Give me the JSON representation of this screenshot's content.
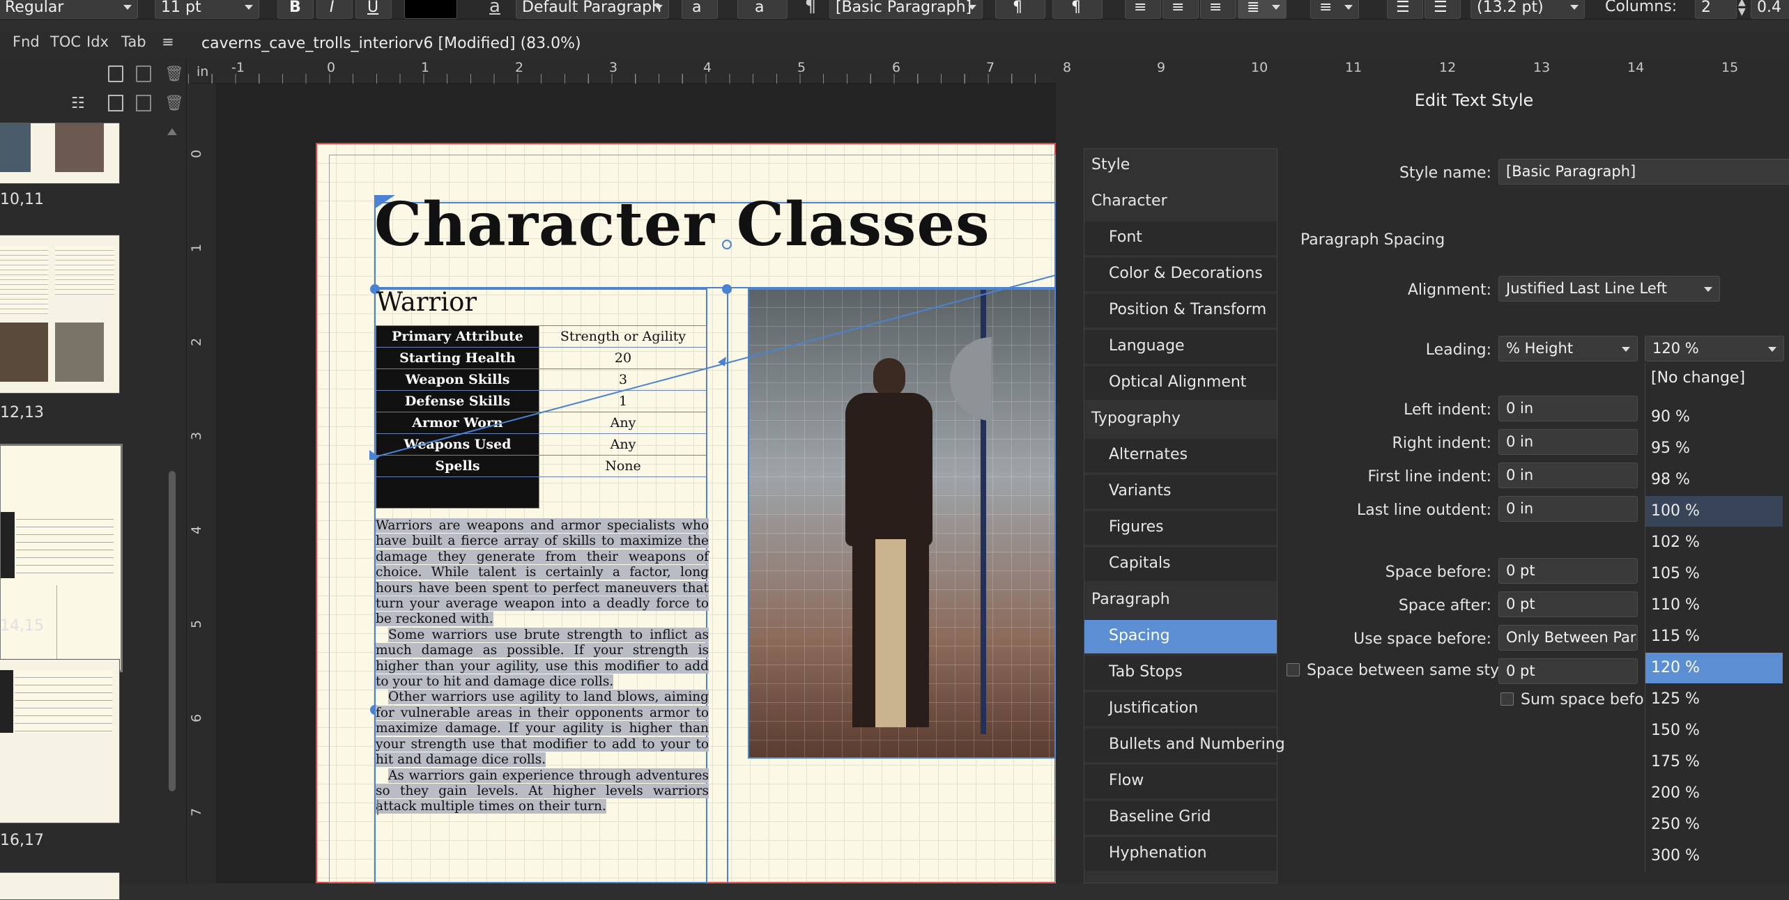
{
  "toolbar": {
    "font_style": "Regular",
    "font_size": "11 pt",
    "bold": "B",
    "italic": "I",
    "underline": "U",
    "text_color": "#000000",
    "char_style_icon": "a",
    "char_style": "Default Paragraph",
    "opentype_icon": "a",
    "paragraph_style_icon": "¶",
    "paragraph_style": "[Basic Paragraph]",
    "leading_value": "(13.2 pt)",
    "columns_label": "Columns:",
    "columns_value": "2",
    "gutter_value": "0.4"
  },
  "left_tabs": [
    "Fnd",
    "TOC",
    "Idx",
    "Tab"
  ],
  "document": {
    "title": "caverns_cave_trolls_interiorv6 [Modified] (83.0%)"
  },
  "pages_panel": {
    "spreads": [
      {
        "label": "10,11"
      },
      {
        "label": "12,13"
      },
      {
        "label": "14,15"
      },
      {
        "label": "16,17"
      }
    ]
  },
  "ruler": {
    "unit": "in",
    "top_ticks": [
      "-1",
      "0",
      "1",
      "2",
      "3",
      "4",
      "5",
      "6",
      "7",
      "8",
      "9",
      "10",
      "11",
      "12",
      "13",
      "14",
      "15"
    ],
    "left_ticks": [
      "0",
      "1",
      "2",
      "3",
      "4",
      "5",
      "6",
      "7"
    ]
  },
  "page": {
    "heading": "Character Classes",
    "subheading": "Warrior",
    "stats": [
      {
        "label": "Primary Attribute",
        "value": "Strength or Agility"
      },
      {
        "label": "Starting Health",
        "value": "20"
      },
      {
        "label": "Weapon Skills",
        "value": "3"
      },
      {
        "label": "Defense Skills",
        "value": "1"
      },
      {
        "label": "Armor Worn",
        "value": "Any"
      },
      {
        "label": "Weapons Used",
        "value": "Any"
      },
      {
        "label": "Spells",
        "value": "None"
      }
    ],
    "paragraphs": [
      "Warriors are weapons and armor specialists who have built a fierce array of skills to maximize the damage they generate from their weapons of choice.  While talent is certainly a factor, long hours have been spent to perfect maneuvers that turn your average weapon into a deadly force to be reckoned with.",
      "Some warriors use brute strength to inflict as much damage as possible.  If your strength is higher than your agility, use this modifier to add to your to hit and damage dice rolls.",
      "Other warriors use agility to land blows, aiming for vulnerable areas in their opponents armor to maximize damage.  If your agility is higher than your strength use that modifier to add to your to hit and damage dice rolls.",
      "As warriors gain experience through adventures so they gain levels.  At higher levels warriors attack multiple times on their turn."
    ]
  },
  "dialog": {
    "title": "Edit Text Style",
    "categories": [
      {
        "label": "Style",
        "level": 1
      },
      {
        "label": "Character",
        "level": 1
      },
      {
        "label": "Font",
        "level": 2
      },
      {
        "label": "Color & Decorations",
        "level": 2
      },
      {
        "label": "Position & Transform",
        "level": 2
      },
      {
        "label": "Language",
        "level": 2
      },
      {
        "label": "Optical Alignment",
        "level": 2
      },
      {
        "label": "Typography",
        "level": 1
      },
      {
        "label": "Alternates",
        "level": 2
      },
      {
        "label": "Variants",
        "level": 2
      },
      {
        "label": "Figures",
        "level": 2
      },
      {
        "label": "Capitals",
        "level": 2
      },
      {
        "label": "Paragraph",
        "level": 1
      },
      {
        "label": "Spacing",
        "level": 2,
        "selected": true
      },
      {
        "label": "Tab Stops",
        "level": 2
      },
      {
        "label": "Justification",
        "level": 2
      },
      {
        "label": "Bullets and Numbering",
        "level": 2
      },
      {
        "label": "Flow",
        "level": 2
      },
      {
        "label": "Baseline Grid",
        "level": 2
      },
      {
        "label": "Hyphenation",
        "level": 2
      }
    ],
    "style_name_label": "Style name:",
    "style_name_value": "[Basic Paragraph]",
    "section_label": "Paragraph Spacing",
    "alignment_label": "Alignment:",
    "alignment_value": "Justified Last Line Left",
    "leading_label": "Leading:",
    "leading_mode": "% Height",
    "leading_value": "120 %",
    "left_indent_label": "Left indent:",
    "left_indent_value": "0 in",
    "right_indent_label": "Right indent:",
    "right_indent_value": "0 in",
    "first_indent_label": "First line indent:",
    "first_indent_value": "0 in",
    "last_outdent_label": "Last line outdent:",
    "last_outdent_value": "0 in",
    "space_before_label": "Space before:",
    "space_before_value": "0 pt",
    "space_after_label": "Space after:",
    "space_after_value": "0 pt",
    "use_space_before_label": "Use space before:",
    "use_space_before_value": "Only Between Paragr",
    "space_same_label": "Space between same styles:",
    "space_same_value": "0 pt",
    "sum_space_label": "Sum space before"
  },
  "leading_options": [
    "[No change]",
    "90 %",
    "95 %",
    "98 %",
    "100 %",
    "102 %",
    "105 %",
    "110 %",
    "115 %",
    "120 %",
    "125 %",
    "150 %",
    "175 %",
    "200 %",
    "250 %",
    "300 %"
  ],
  "leading_selected": "120 %",
  "leading_hover": "100 %"
}
